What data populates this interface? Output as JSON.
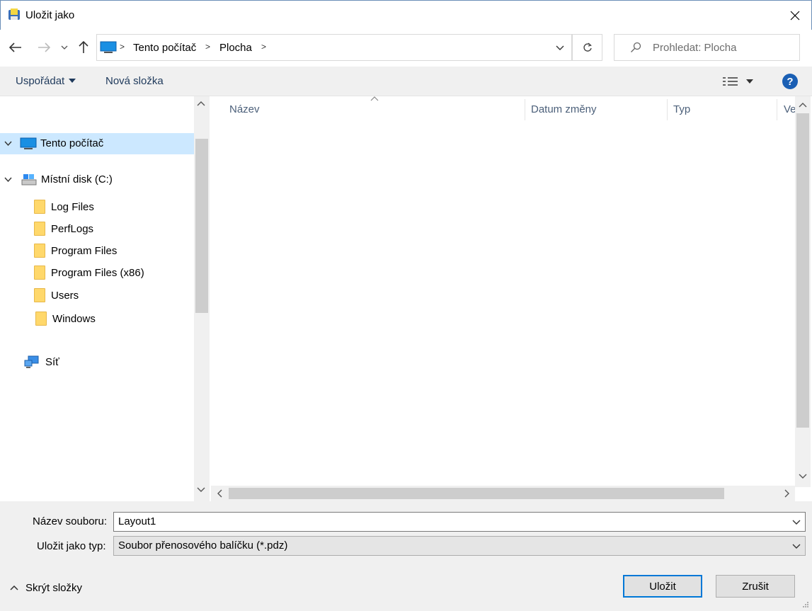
{
  "window": {
    "title": "Uložit jako",
    "close_label": "×"
  },
  "address": {
    "crumbs": [
      "Tento počítač",
      "Plocha"
    ],
    "separator": ">"
  },
  "search": {
    "placeholder": "Prohledat: Plocha"
  },
  "toolbar": {
    "organize_label": "Uspořádat",
    "new_folder_label": "Nová složka",
    "help_label": "?"
  },
  "navpane": {
    "this_pc": "Tento počítač",
    "local_disk": "Místní disk (C:)",
    "folders": [
      "Log Files",
      "PerfLogs",
      "Program Files",
      "Program Files (x86)",
      "Users",
      "Windows"
    ],
    "network": "Síť"
  },
  "filepane": {
    "columns": [
      "Název",
      "Datum změny",
      "Typ",
      "Ve"
    ]
  },
  "bottom": {
    "filename_label": "Název souboru:",
    "filename_value": "Layout1",
    "filetype_label": "Uložit jako typ:",
    "filetype_value": "Soubor přenosového balíčku (*.pdz)",
    "hide_folders_label": "Skrýt složky",
    "save_label": "Uložit",
    "cancel_label": "Zrušit"
  },
  "colors": {
    "selection": "#cce8ff",
    "accent": "#0078d7",
    "toolbar_bg": "#f0f0f0"
  }
}
